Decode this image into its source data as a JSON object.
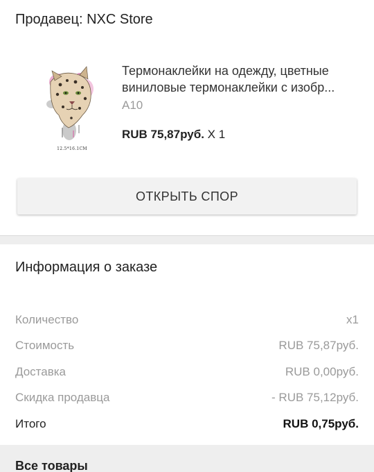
{
  "seller": {
    "label": "Продавец: NXC Store"
  },
  "product": {
    "title": "Термонаклейки на одежду, цветные виниловые термонаклейки с изобр...",
    "variant": "A10",
    "price": "RUB 75,87руб.",
    "quantity": "X 1",
    "image_caption": "12.5*16.1CM",
    "image_subject": "leopard-print"
  },
  "actions": {
    "dispute_label": "ОТКРЫТЬ СПОР"
  },
  "order_info": {
    "title": "Информация о заказе",
    "rows": [
      {
        "label": "Количество",
        "value": "x1"
      },
      {
        "label": "Стоимость",
        "value": "RUB 75,87руб."
      },
      {
        "label": "Доставка",
        "value": "RUB 0,00руб."
      },
      {
        "label": "Скидка продавца",
        "value": "- RUB 75,12руб."
      },
      {
        "label": "Итого",
        "value": "RUB 0,75руб."
      }
    ]
  },
  "all_goods": {
    "title": "Все товары"
  }
}
